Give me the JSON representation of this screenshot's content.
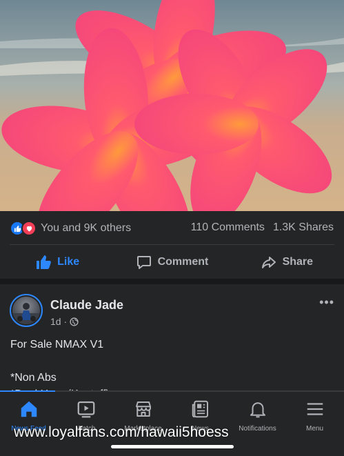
{
  "post": {
    "image_alt": "Pink plumeria flowers on a beach",
    "reactions": {
      "icons": [
        "like-icon",
        "love-icon"
      ],
      "text": "You and 9K others",
      "comments": "110 Comments",
      "shares": "1.3K Shares"
    },
    "actions": {
      "like": "Like",
      "comment": "Comment",
      "share": "Share"
    }
  },
  "next_post": {
    "author": "Claude Jade",
    "time": "1d ·",
    "privacy_icon": "globe-icon",
    "more_icon": "ellipsis-icon",
    "lines": [
      "For Sale NMAX V1",
      "",
      "*Non Abs",
      "*Dual Horn (Kaatoff)"
    ]
  },
  "tabs": [
    {
      "label": "News Feed",
      "icon": "home-icon",
      "active": true
    },
    {
      "label": "Watch",
      "icon": "watch-icon",
      "active": false
    },
    {
      "label": "Marketplace",
      "icon": "marketplace-icon",
      "active": false
    },
    {
      "label": "News",
      "icon": "news-icon",
      "active": false
    },
    {
      "label": "Notifications",
      "icon": "bell-icon",
      "active": false
    },
    {
      "label": "Menu",
      "icon": "menu-icon",
      "active": false
    }
  ],
  "watermark": "www.loyalfans.com/hawaii5hoess",
  "colors": {
    "accent": "#2d88ff",
    "background": "#18191a",
    "card": "#242526",
    "text_secondary": "#b0b3b8"
  }
}
